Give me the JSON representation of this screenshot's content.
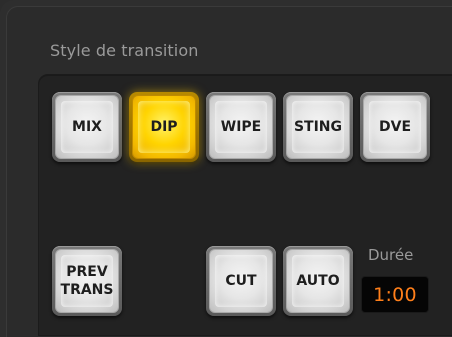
{
  "panel": {
    "title": "Style de transition"
  },
  "style_buttons": [
    {
      "label": "MIX",
      "active": false
    },
    {
      "label": "DIP",
      "active": true
    },
    {
      "label": "WIPE",
      "active": false
    },
    {
      "label": "STING",
      "active": false
    },
    {
      "label": "DVE",
      "active": false
    }
  ],
  "prev_trans": {
    "label_line1": "PREV",
    "label_line2": "TRANS"
  },
  "cut": {
    "label": "CUT"
  },
  "auto": {
    "label": "AUTO"
  },
  "duration": {
    "label": "Durée",
    "value": "1:00"
  },
  "colors": {
    "active": "#ffd400",
    "duration_text": "#ff7f1a",
    "panel_bg": "#2e2e2e"
  }
}
